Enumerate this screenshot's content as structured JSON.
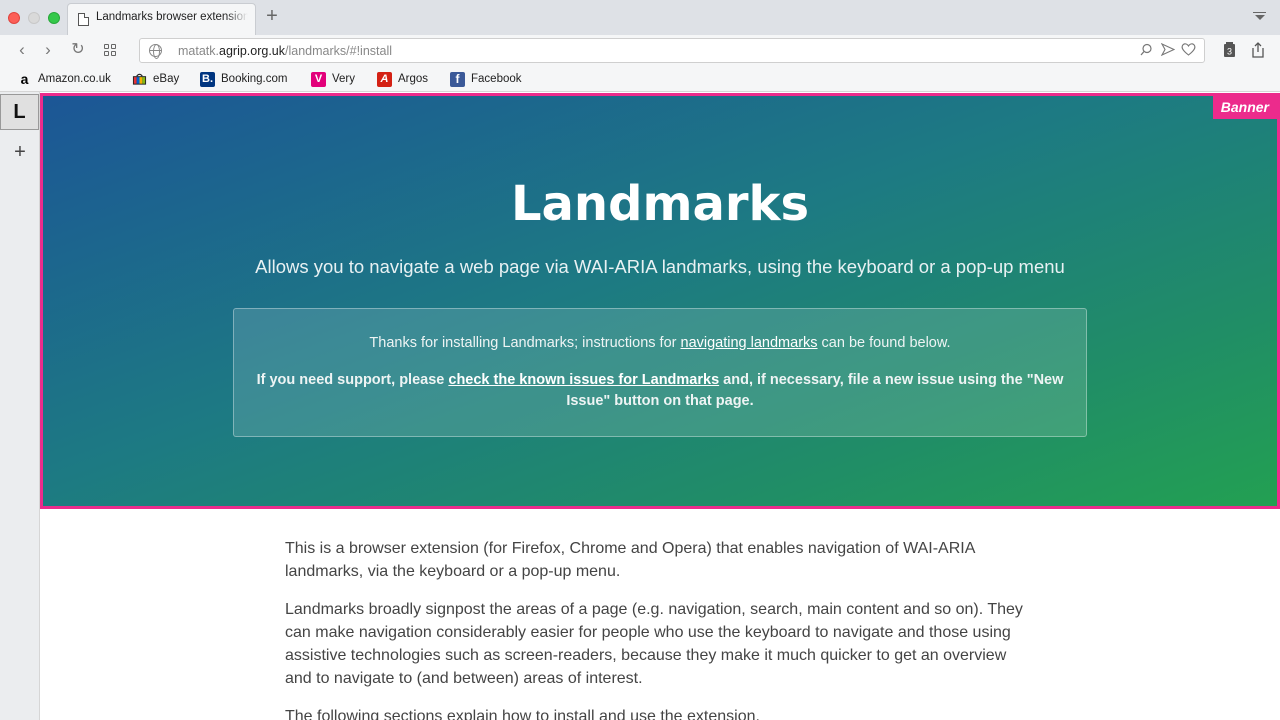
{
  "browser": {
    "tab": {
      "title": "Landmarks browser extension"
    },
    "url": {
      "prefix": "matatk.",
      "host": "agrip.org.uk",
      "path": "/landmarks/#!install"
    },
    "bookmarks": [
      {
        "label": "Amazon.co.uk",
        "icon": "amazon-icon",
        "color": "#000000"
      },
      {
        "label": "eBay",
        "icon": "ebay-icon",
        "color": "#e53238"
      },
      {
        "label": "Booking.com",
        "icon": "booking-icon",
        "color": "#003580"
      },
      {
        "label": "Very",
        "icon": "very-icon",
        "color": "#e2007a"
      },
      {
        "label": "Argos",
        "icon": "argos-icon",
        "color": "#d42114"
      },
      {
        "label": "Facebook",
        "icon": "facebook-icon",
        "color": "#3b5998"
      }
    ]
  },
  "sidebar": {
    "panel_label": "L"
  },
  "banner": {
    "tag": "Banner",
    "title": "Landmarks",
    "lede": "Allows you to navigate a web page via WAI-ARIA landmarks, using the keyboard or a pop-up menu",
    "notice": {
      "line1_before": "Thanks for installing Landmarks; instructions for ",
      "line1_link": "navigating landmarks",
      "line1_after": " can be found below.",
      "line2_before": "If you need support, please ",
      "line2_link": "check the known issues for Landmarks",
      "line2_after": " and, if necessary, file a new issue using the \"New Issue\" button on that page."
    },
    "border_color": "#ec2b8c"
  },
  "content": {
    "paragraphs": [
      "This is a browser extension (for Firefox, Chrome and Opera) that enables navigation of WAI-ARIA landmarks, via the keyboard or a pop-up menu.",
      "Landmarks broadly signpost the areas of a page (e.g. navigation, search, main content and so on). They can make navigation considerably easier for people who use the keyboard to navigate and those using assistive technologies such as screen-readers, because they make it much quicker to get an overview and to navigate to (and between) areas of interest.",
      "The following sections explain how to install and use the extension."
    ]
  }
}
